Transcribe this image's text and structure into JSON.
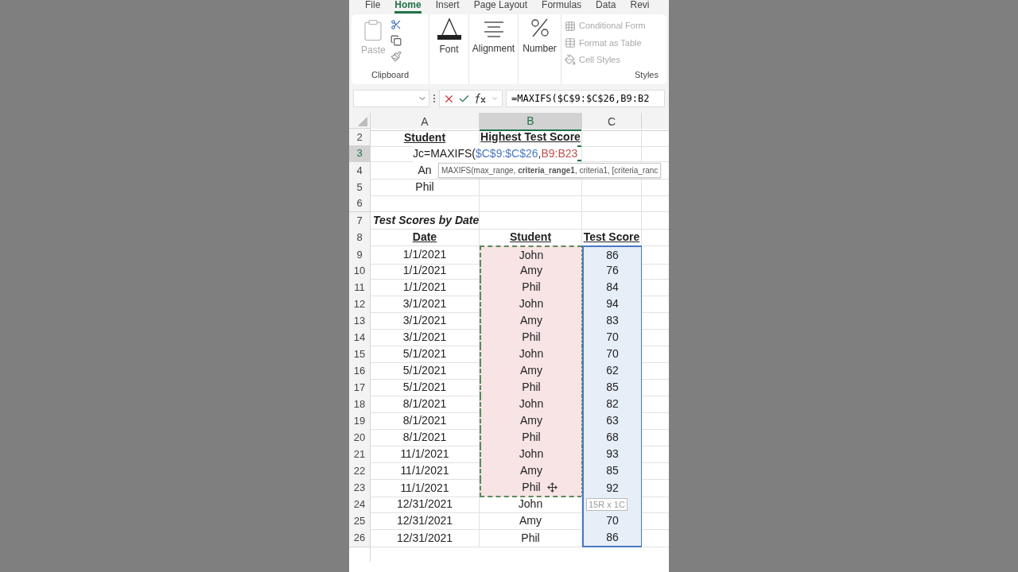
{
  "ribbon_tabs": [
    {
      "label": "File",
      "selected": false
    },
    {
      "label": "Home",
      "selected": true
    },
    {
      "label": "Insert",
      "selected": false
    },
    {
      "label": "Page Layout",
      "selected": false
    },
    {
      "label": "Formulas",
      "selected": false
    },
    {
      "label": "Data",
      "selected": false
    },
    {
      "label": "Revi",
      "selected": false
    }
  ],
  "ribbon": {
    "clipboard": {
      "paste": "Paste",
      "label": "Clipboard"
    },
    "font": "Font",
    "alignment": "Alignment",
    "number": "Number",
    "styles": {
      "items": [
        "Conditional Form",
        "Format as Table",
        "Cell Styles"
      ],
      "label": "Styles"
    }
  },
  "formula_bar": {
    "formula": "=MAXIFS($C$9:$C$26,B9:B2"
  },
  "columns": [
    {
      "label": "A",
      "selected": false
    },
    {
      "label": "B",
      "selected": true
    },
    {
      "label": "C",
      "selected": false
    }
  ],
  "rows": [
    {
      "number": "2",
      "selected": false,
      "kind": "header",
      "cells": [
        "Student",
        "Highest Test Score",
        ""
      ]
    },
    {
      "number": "3",
      "selected": true,
      "kind": "editing",
      "parts": [
        {
          "text": "Jc=MAXIFS("
        },
        {
          "text": "$C$9:$C$26",
          "color": "#4a78c2"
        },
        {
          "text": ","
        },
        {
          "text": "B9:B23",
          "color": "#c0504d"
        }
      ]
    },
    {
      "number": "4",
      "selected": false,
      "kind": "data",
      "cells": [
        "An",
        "",
        ""
      ],
      "tooltip": "MAXIFS(max_range, **criteria_range1**, criteria1, [criteria_ranc"
    },
    {
      "number": "5",
      "selected": false,
      "kind": "data",
      "cells": [
        "Phil",
        "",
        ""
      ]
    },
    {
      "number": "6",
      "selected": false,
      "kind": "data",
      "cells": [
        "",
        "",
        ""
      ]
    },
    {
      "number": "7",
      "selected": false,
      "kind": "title",
      "cells": [
        "Test Scores by Date",
        "",
        ""
      ]
    },
    {
      "number": "8",
      "selected": false,
      "kind": "header",
      "cells": [
        "Date",
        "Student",
        "Test Score"
      ]
    },
    {
      "number": "9",
      "selected": false,
      "kind": "data",
      "cells": [
        "1/1/2021",
        "John",
        "86"
      ],
      "criteria": true,
      "max": true
    },
    {
      "number": "10",
      "selected": false,
      "kind": "data",
      "cells": [
        "1/1/2021",
        "Amy",
        "76"
      ],
      "criteria": true,
      "max": true
    },
    {
      "number": "11",
      "selected": false,
      "kind": "data",
      "cells": [
        "1/1/2021",
        "Phil",
        "84"
      ],
      "criteria": true,
      "max": true
    },
    {
      "number": "12",
      "selected": false,
      "kind": "data",
      "cells": [
        "3/1/2021",
        "John",
        "94"
      ],
      "criteria": true,
      "max": true
    },
    {
      "number": "13",
      "selected": false,
      "kind": "data",
      "cells": [
        "3/1/2021",
        "Amy",
        "83"
      ],
      "criteria": true,
      "max": true
    },
    {
      "number": "14",
      "selected": false,
      "kind": "data",
      "cells": [
        "3/1/2021",
        "Phil",
        "70"
      ],
      "criteria": true,
      "max": true
    },
    {
      "number": "15",
      "selected": false,
      "kind": "data",
      "cells": [
        "5/1/2021",
        "John",
        "70"
      ],
      "criteria": true,
      "max": true
    },
    {
      "number": "16",
      "selected": false,
      "kind": "data",
      "cells": [
        "5/1/2021",
        "Amy",
        "62"
      ],
      "criteria": true,
      "max": true
    },
    {
      "number": "17",
      "selected": false,
      "kind": "data",
      "cells": [
        "5/1/2021",
        "Phil",
        "85"
      ],
      "criteria": true,
      "max": true
    },
    {
      "number": "18",
      "selected": false,
      "kind": "data",
      "cells": [
        "8/1/2021",
        "John",
        "82"
      ],
      "criteria": true,
      "max": true
    },
    {
      "number": "19",
      "selected": false,
      "kind": "data",
      "cells": [
        "8/1/2021",
        "Amy",
        "63"
      ],
      "criteria": true,
      "max": true
    },
    {
      "number": "20",
      "selected": false,
      "kind": "data",
      "cells": [
        "8/1/2021",
        "Phil",
        "68"
      ],
      "criteria": true,
      "max": true
    },
    {
      "number": "21",
      "selected": false,
      "kind": "data",
      "cells": [
        "11/1/2021",
        "John",
        "93"
      ],
      "criteria": true,
      "max": true
    },
    {
      "number": "22",
      "selected": false,
      "kind": "data",
      "cells": [
        "11/1/2021",
        "Amy",
        "85"
      ],
      "criteria": true,
      "max": true
    },
    {
      "number": "23",
      "selected": false,
      "kind": "data",
      "cells": [
        "11/1/2021",
        "Phil",
        "92"
      ],
      "criteria": true,
      "max": true,
      "cursor": true
    },
    {
      "number": "24",
      "selected": false,
      "kind": "data",
      "cells": [
        "12/31/2021",
        "John",
        ""
      ],
      "criteria": false,
      "max": true,
      "range_tag": "15R x 1C"
    },
    {
      "number": "25",
      "selected": false,
      "kind": "data",
      "cells": [
        "12/31/2021",
        "Amy",
        "70"
      ],
      "criteria": false,
      "max": true
    },
    {
      "number": "26",
      "selected": false,
      "kind": "data",
      "cells": [
        "12/31/2021",
        "Phil",
        "86"
      ],
      "criteria": false,
      "max": true
    }
  ]
}
